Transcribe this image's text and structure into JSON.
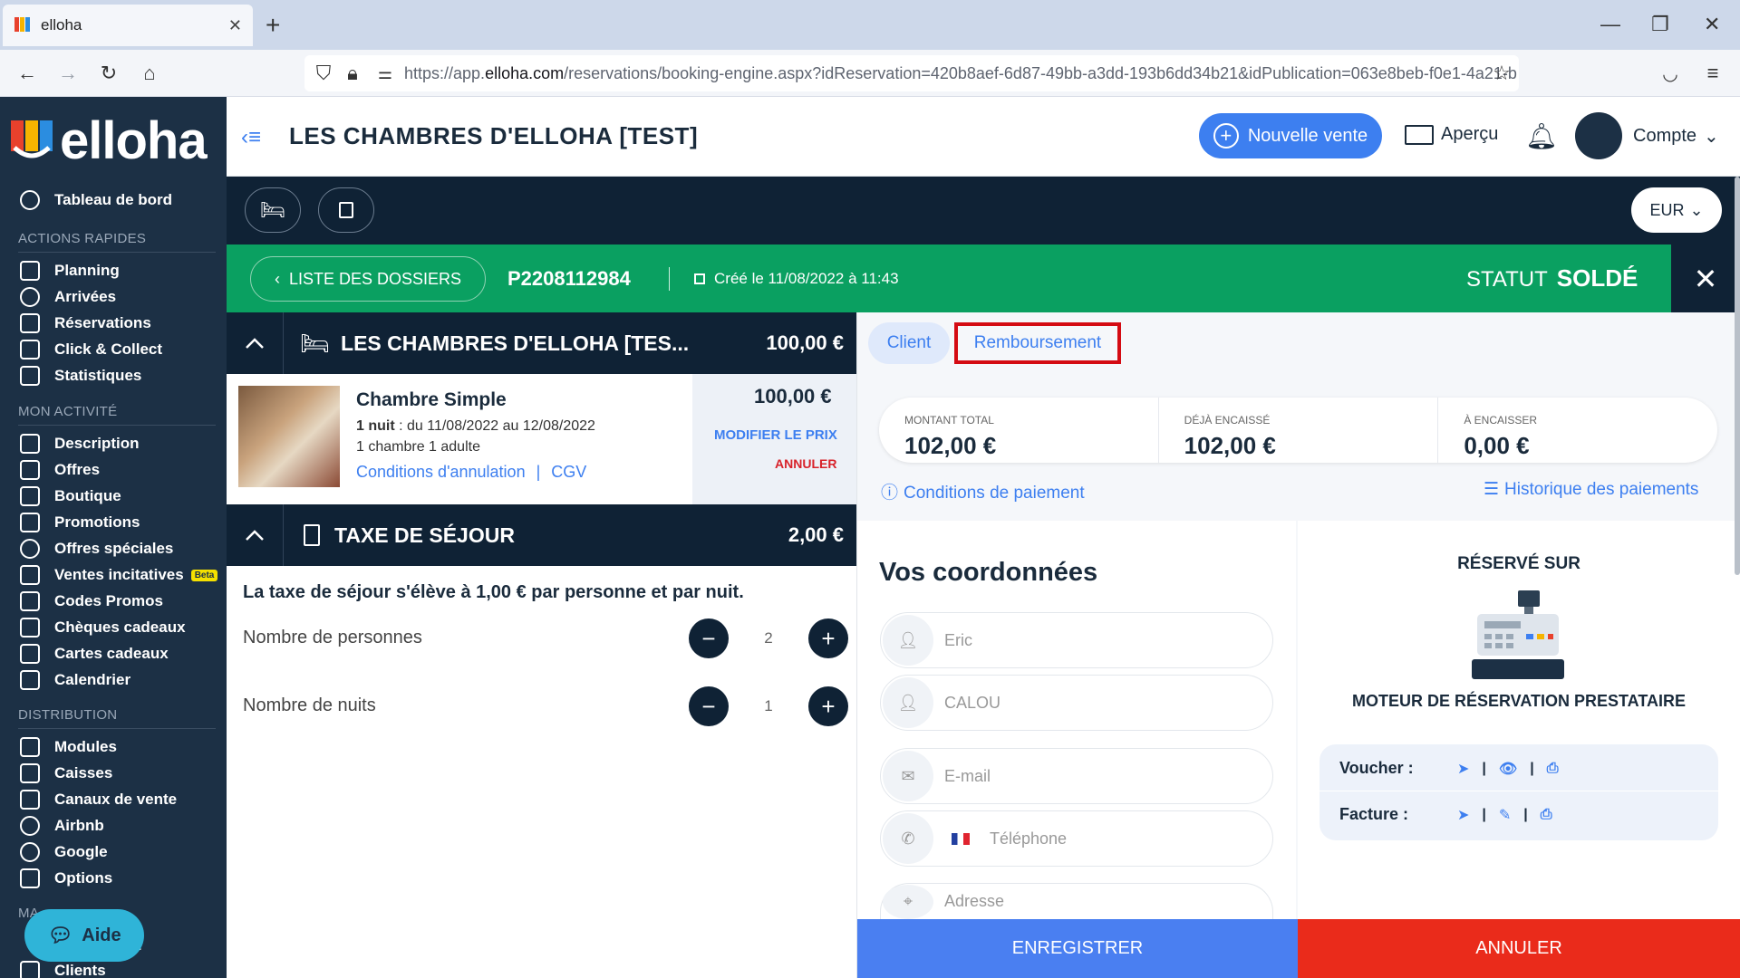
{
  "browser": {
    "tab_title": "elloha",
    "url_prefix": "https://app.",
    "url_domain": "elloha.com",
    "url_rest": "/reservations/booking-engine.aspx?idReservation=420b8aef-6d87-49bb-a3dd-193b6dd34b21&idPublication=063e8beb-f0e1-4a21-b"
  },
  "sidebar": {
    "logo_text": "elloha",
    "dashboard": "Tableau de bord",
    "section_quick": "ACTIONS RAPIDES",
    "quick": [
      "Planning",
      "Arrivées",
      "Réservations",
      "Click & Collect",
      "Statistiques"
    ],
    "section_activity": "MON ACTIVITÉ",
    "activity": [
      "Description",
      "Offres",
      "Boutique",
      "Promotions",
      "Offres spéciales",
      "Ventes incitatives",
      "Codes Promos",
      "Chèques cadeaux",
      "Cartes cadeaux",
      "Calendrier"
    ],
    "beta_label": "Beta",
    "section_distribution": "DISTRIBUTION",
    "distribution": [
      "Modules",
      "Caisses",
      "Canaux de vente",
      "Airbnb",
      "Google",
      "Options"
    ],
    "section_partial": "MA",
    "partial_item": "t",
    "clients": "Clients",
    "help": "Aide"
  },
  "header": {
    "title": "LES CHAMBRES D'ELLOHA [TEST]",
    "new_sale": "Nouvelle vente",
    "preview": "Aperçu",
    "account": "Compte"
  },
  "toolbar": {
    "currency": "EUR"
  },
  "dossier": {
    "back_label": "LISTE DES DOSSIERS",
    "number": "P2208112984",
    "created": "Créé le 11/08/2022 à 11:43",
    "status_label": "STATUT",
    "status_value": "SOLDÉ"
  },
  "room": {
    "header_title": "LES CHAMBRES D'ELLOHA [TES...",
    "header_amount": "100,00 €",
    "name": "Chambre Simple",
    "nights_bold": "1 nuit",
    "dates": " : du 11/08/2022 au 12/08/2022",
    "occupancy": "1 chambre 1 adulte",
    "cancel_conditions": "Conditions d'annulation",
    "separator": "|",
    "cgv": "CGV",
    "price": "100,00 €",
    "modify_price": "MODIFIER LE PRIX",
    "cancel": "ANNULER"
  },
  "tax": {
    "header_title": "TAXE DE SÉJOUR",
    "header_amount": "2,00 €",
    "description": "La taxe de séjour s'élève à 1,00 € par personne et par nuit.",
    "persons_label": "Nombre de personnes",
    "persons_value": "2",
    "nights_label": "Nombre de nuits",
    "nights_value": "1"
  },
  "right": {
    "tab_client": "Client",
    "tab_refund": "Remboursement",
    "total_label": "MONTANT TOTAL",
    "total_value": "102,00 €",
    "paid_label": "DÉJÀ ENCAISSÉ",
    "paid_value": "102,00 €",
    "due_label": "À ENCAISSER",
    "due_value": "0,00 €",
    "payment_conditions": "Conditions de paiement",
    "payment_history": "Historique des paiements",
    "form_title": "Vos coordonnées",
    "first_name": "Eric",
    "last_name": "CALOU",
    "email_placeholder": "E-mail",
    "phone_placeholder": "Téléphone",
    "address_placeholder": "Adresse",
    "reserved_on": "RÉSERVÉ SUR",
    "engine": "MOTEUR DE RÉSERVATION PRESTATAIRE",
    "voucher": "Voucher :",
    "invoice": "Facture :",
    "save": "ENREGISTRER",
    "cancel": "ANNULER"
  },
  "colors": {
    "sidebar": "#1c3045",
    "green_bar": "#0aa061",
    "accent": "#3d7ff0",
    "danger": "#ea2b1b"
  }
}
